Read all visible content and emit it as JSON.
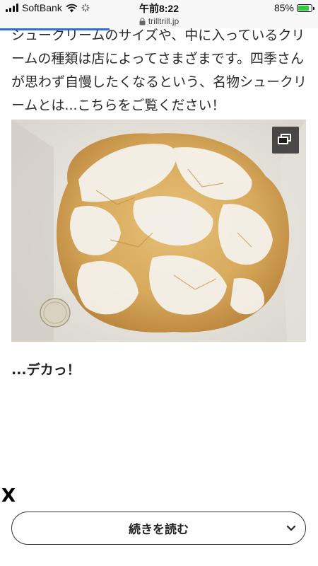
{
  "status_bar": {
    "carrier": "SoftBank",
    "time": "午前8:22",
    "url": "trilltrill.jp",
    "battery_percent": "85%",
    "battery_level": 0.85
  },
  "article": {
    "paragraph_lines": [
      "シュークリームのサイズや、中に入っているクリ",
      "ームの種類は店によってさまざまです。四季さん",
      "が思わず自慢したくなるという、名物シュークリ",
      "ームとは...こちらをご覧ください！"
    ]
  },
  "caption": "...デカっ！",
  "close_label": "X",
  "read_more_label": "続きを読む",
  "colors": {
    "accent": "#2f6fd6",
    "battery": "#2ecc40"
  },
  "icons": [
    "signal-icon",
    "wifi-icon",
    "loading-icon",
    "lock-icon",
    "battery-icon",
    "gallery-icon",
    "chevron-down-icon"
  ]
}
